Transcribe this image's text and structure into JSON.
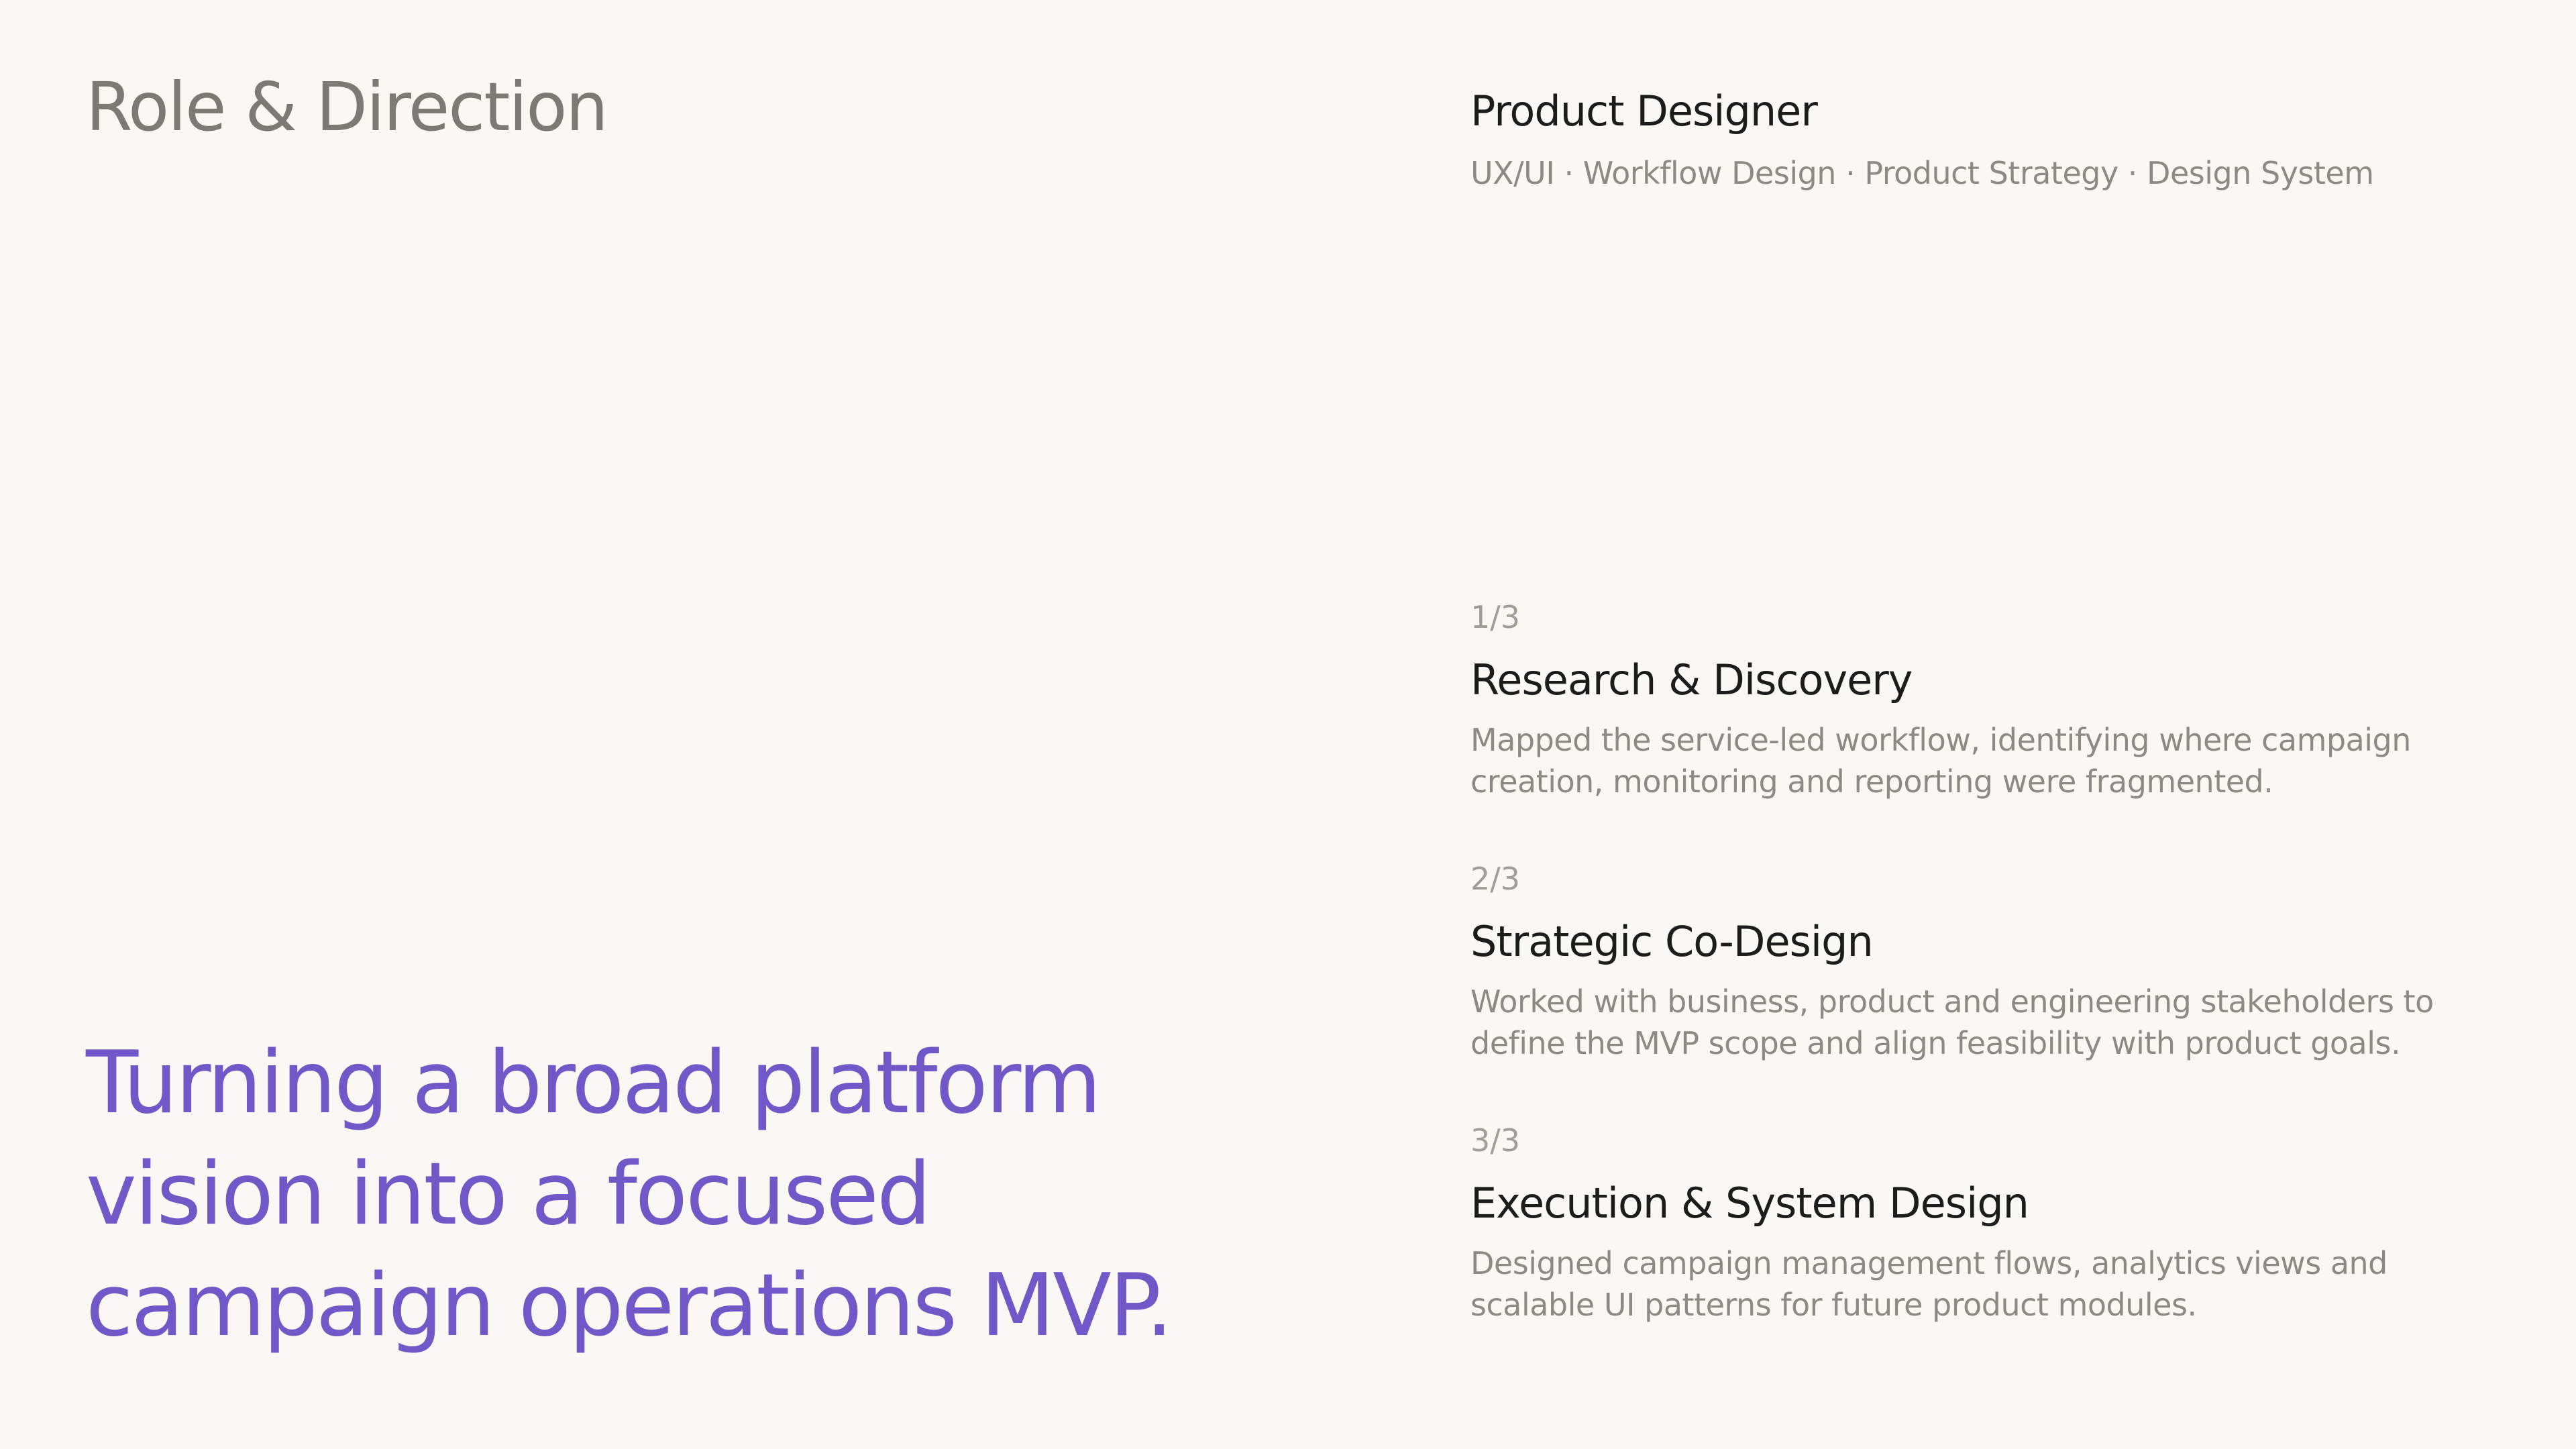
{
  "section": {
    "title": "Role & Direction"
  },
  "headline": "Turning a broad platform vision into a focused campaign operations MVP.",
  "role": {
    "title": "Product Designer",
    "tags": "UX/UI · Workflow Design · Product Strategy · Design System"
  },
  "steps": [
    {
      "index": "1/3",
      "title": "Research & Discovery",
      "description": "Mapped the service-led workflow, identifying where campaign creation, monitoring and reporting were fragmented."
    },
    {
      "index": "2/3",
      "title": "Strategic Co-Design",
      "description": "Worked with business, product and engineering stakeholders to define the MVP scope and align feasibility with product goals."
    },
    {
      "index": "3/3",
      "title": "Execution & System Design",
      "description": "Designed campaign management flows, analytics views and scalable UI patterns for future product modules."
    }
  ],
  "colors": {
    "background": "#f9f8f4",
    "accent": "#7158c8",
    "heading": "#1c1c1c",
    "muted": "#8d8a86"
  }
}
